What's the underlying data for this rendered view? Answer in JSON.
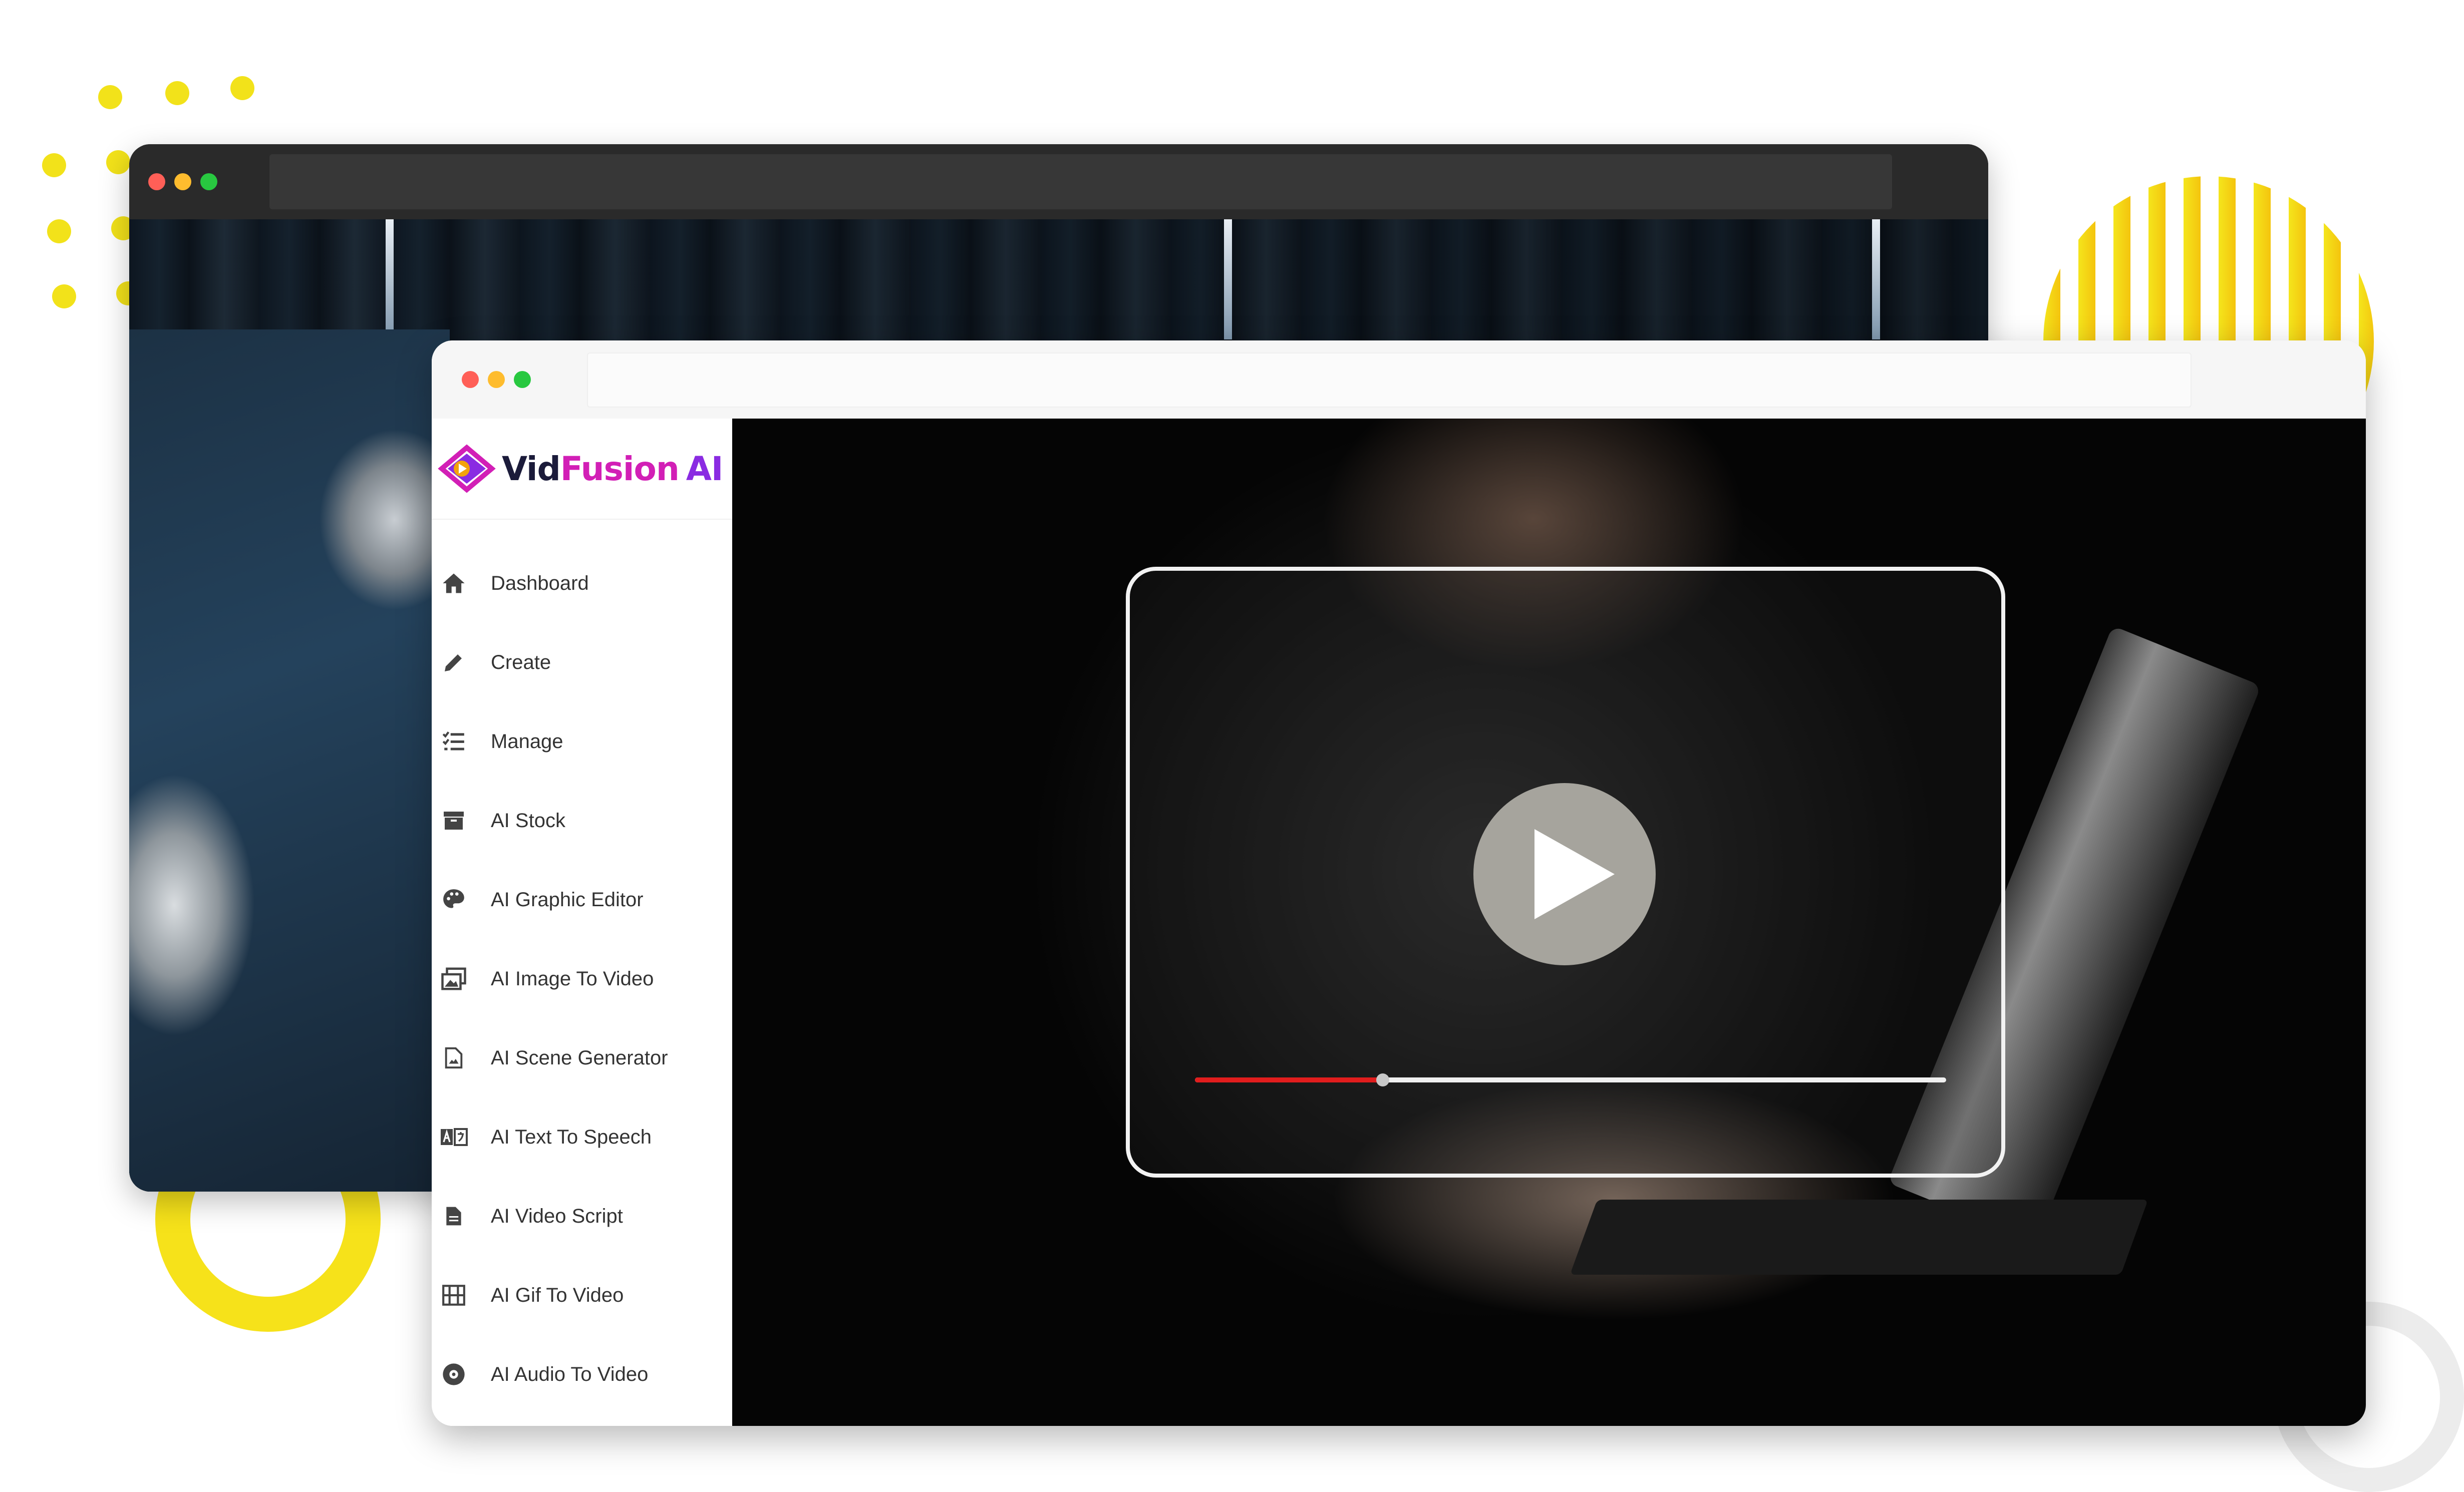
{
  "brand": {
    "name_part1": "Vid",
    "name_part2": "Fusion",
    "name_part3": "AI",
    "colors": {
      "dark": "#1b1b3a",
      "pink": "#d21fb6",
      "purple": "#8a2be2"
    }
  },
  "sidebar": {
    "items": [
      {
        "label": "Dashboard",
        "icon": "home-icon"
      },
      {
        "label": "Create",
        "icon": "pencil-icon"
      },
      {
        "label": "Manage",
        "icon": "list-check-icon"
      },
      {
        "label": "AI Stock",
        "icon": "archive-icon"
      },
      {
        "label": "AI Graphic Editor",
        "icon": "palette-icon"
      },
      {
        "label": "AI Image To Video",
        "icon": "images-icon"
      },
      {
        "label": "AI Scene Generator",
        "icon": "file-image-icon"
      },
      {
        "label": "AI Text To Speech",
        "icon": "translate-icon"
      },
      {
        "label": "AI Video Script",
        "icon": "file-text-icon"
      },
      {
        "label": "AI Gif To Video",
        "icon": "film-icon"
      },
      {
        "label": "AI Audio To Video",
        "icon": "disc-icon"
      }
    ]
  },
  "player": {
    "progress": 0.25,
    "colors": {
      "progress_fill": "#e11d1d",
      "track": "#f0f0f0",
      "play_button": "#a6a49d"
    }
  },
  "window_controls": {
    "close": "#ff5f57",
    "minimize": "#febc2e",
    "maximize": "#28c840"
  },
  "decor": {
    "accent_yellow": "#f2e21a"
  }
}
